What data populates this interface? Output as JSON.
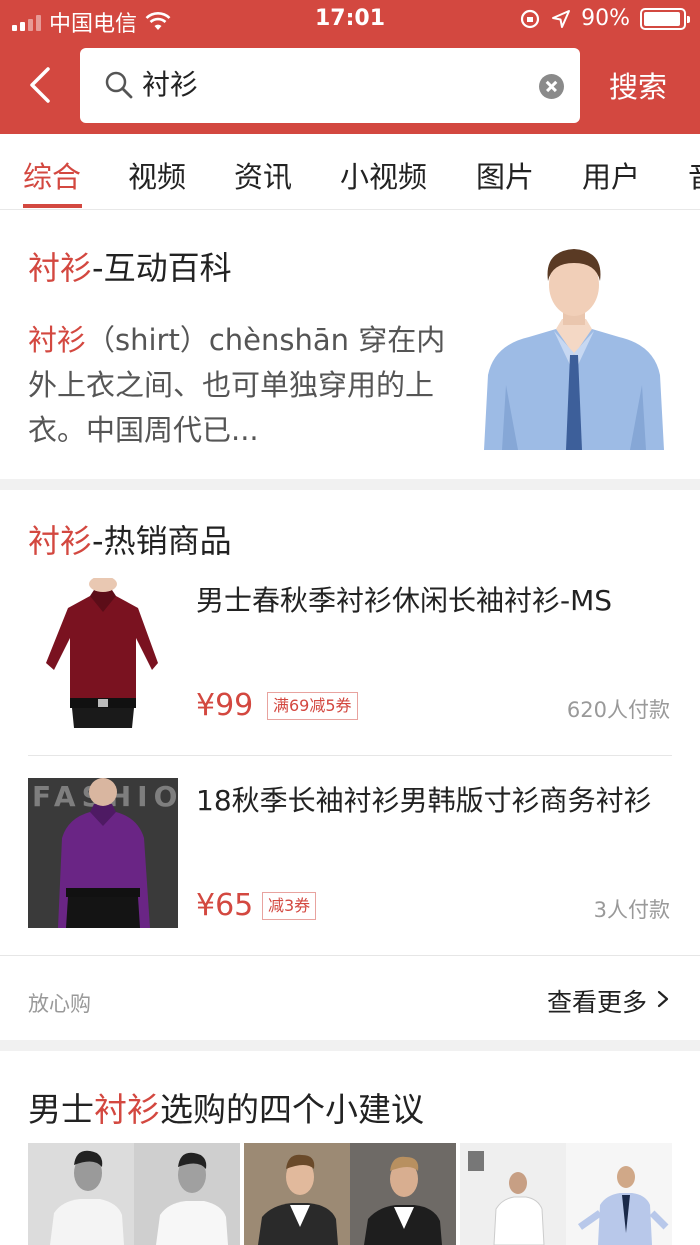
{
  "status_bar": {
    "carrier": "中国电信",
    "time": "17:01",
    "battery": "90%"
  },
  "search": {
    "query": "衬衫",
    "button_label": "搜索"
  },
  "tabs": [
    {
      "label": "综合",
      "active": true
    },
    {
      "label": "视频"
    },
    {
      "label": "资讯"
    },
    {
      "label": "小视频"
    },
    {
      "label": "图片"
    },
    {
      "label": "用户"
    },
    {
      "label": "音"
    }
  ],
  "baike": {
    "title_keyword": "衬衫",
    "title_suffix": "-互动百科",
    "desc_keyword": "衬衫",
    "desc_text": "（shirt）chènshān 穿在内外上衣之间、也可单独穿用的上衣。中国周代已..."
  },
  "hot_goods": {
    "title_keyword": "衬衫",
    "title_suffix": "-热销商品",
    "products": [
      {
        "title": "男士春秋季衬衫休闲长袖衬衫-MS",
        "price": "¥99",
        "coupon": "满69减5券",
        "buyers": "620人付款"
      },
      {
        "title": "18秋季长袖衬衫男韩版寸衫商务衬衫",
        "price": "¥65",
        "coupon": "减3券",
        "buyers": "3人付款"
      }
    ],
    "image_text": "FASHION",
    "footer_brand": "放心购",
    "more_label": "查看更多"
  },
  "article": {
    "title_prefix": "男士",
    "title_keyword": "衬衫",
    "title_suffix": "选购的四个小建议"
  },
  "colors": {
    "accent": "#d34840",
    "product1_shirt": "#7a1220",
    "product2_shirt": "#6a2585"
  }
}
